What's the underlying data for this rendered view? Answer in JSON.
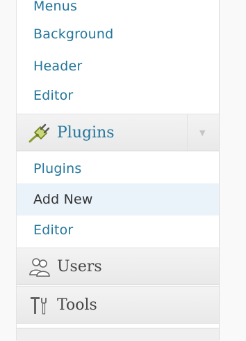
{
  "submenu_top": {
    "items": [
      {
        "label": "Menus"
      },
      {
        "label": "Background"
      },
      {
        "label": "Header"
      },
      {
        "label": "Editor"
      }
    ]
  },
  "plugins_menu": {
    "label": "Plugins",
    "icon": "plug-icon",
    "toggle_icon": "triangle-down-icon",
    "submenu": [
      {
        "label": "Plugins"
      },
      {
        "label": "Add New",
        "current": true
      },
      {
        "label": "Editor"
      }
    ]
  },
  "users_menu": {
    "label": "Users",
    "icon": "users-icon"
  },
  "tools_menu": {
    "label": "Tools",
    "icon": "tools-icon"
  },
  "colors": {
    "link": "#21759b",
    "text": "#464646",
    "current_bg": "#eaf2fa"
  }
}
